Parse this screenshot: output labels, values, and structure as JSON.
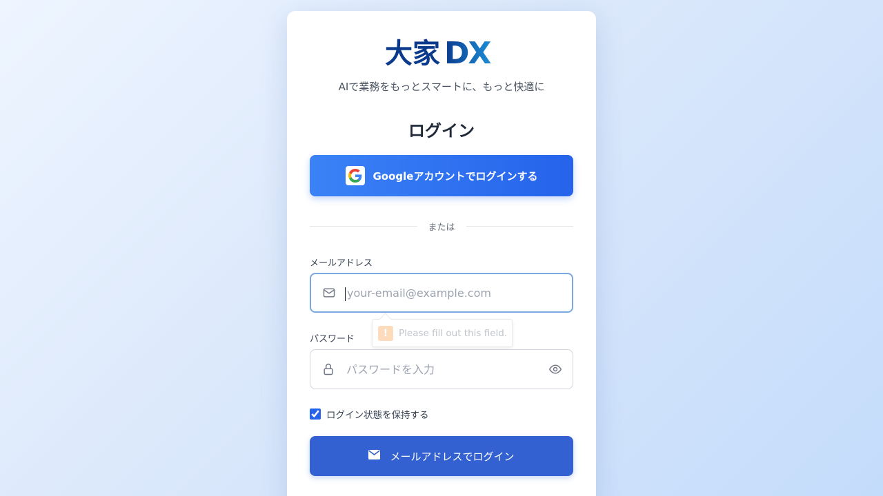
{
  "brand": {
    "logo_text_jp": "大家",
    "logo_text_en": "DX",
    "tagline": "AIで業務をもっとスマートに、もっと快適に",
    "colors": {
      "primary": "#2563eb",
      "submit": "#3461d1",
      "logo_dark": "#0b3a8c",
      "logo_light": "#1d8ed8"
    }
  },
  "login": {
    "heading": "ログイン",
    "google_button": "Googleアカウントでログインする",
    "divider": "または",
    "email": {
      "label": "メールアドレス",
      "placeholder": "your-email@example.com",
      "value": "",
      "icon": "mail-icon"
    },
    "validation_tooltip": "Please fill out this field.",
    "password": {
      "label": "パスワード",
      "placeholder": "パスワードを入力",
      "value": "",
      "icon": "lock-icon",
      "toggle_icon": "eye-icon"
    },
    "remember_me": {
      "label": "ログイン状態を保持する",
      "checked": true
    },
    "submit_button": "メールアドレスでログイン",
    "submit_icon": "envelope-icon"
  }
}
